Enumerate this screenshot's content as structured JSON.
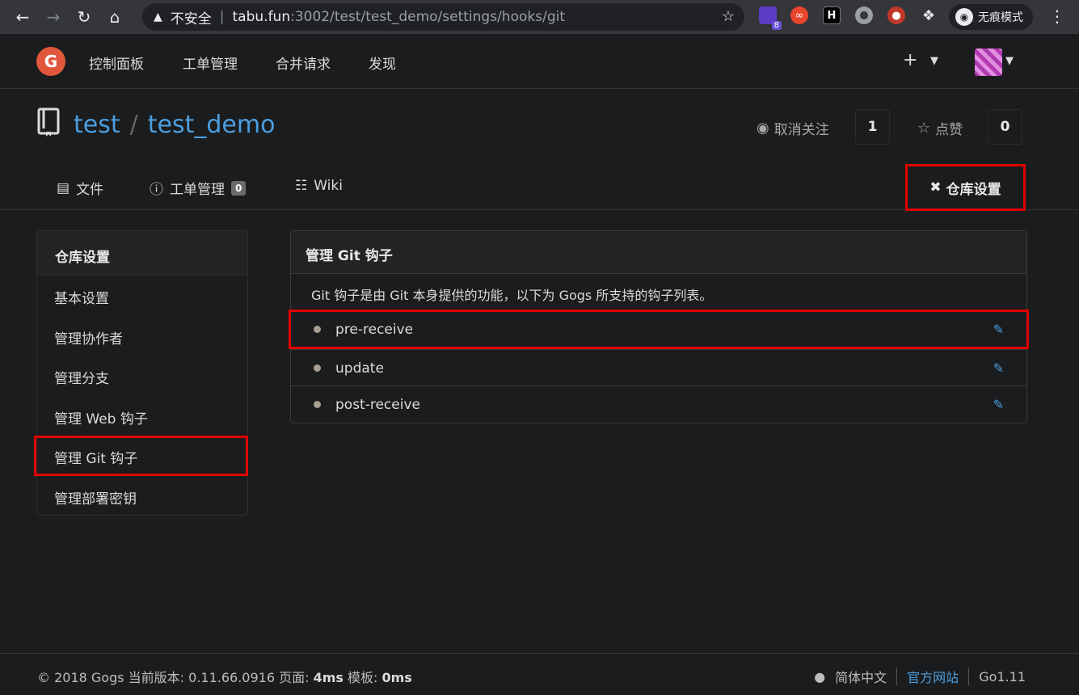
{
  "browser": {
    "insecure_label": "不安全",
    "url_host": "tabu.fun",
    "url_rest": ":3002/test/test_demo/settings/hooks/git",
    "incognito_label": "无痕模式",
    "ext_badge": "8"
  },
  "header": {
    "nav": [
      "控制面板",
      "工单管理",
      "合并请求",
      "发现"
    ]
  },
  "repo": {
    "owner": "test",
    "name": "test_demo",
    "watch_label": "取消关注",
    "watch_count": "1",
    "star_label": "点赞",
    "star_count": "0"
  },
  "tabs": {
    "files": "文件",
    "issues": "工单管理",
    "issues_count": "0",
    "wiki": "Wiki",
    "settings": "仓库设置"
  },
  "sidebar": {
    "title": "仓库设置",
    "items": [
      "基本设置",
      "管理协作者",
      "管理分支",
      "管理 Web 钩子",
      "管理 Git 钩子",
      "管理部署密钥"
    ]
  },
  "panel": {
    "title": "管理 Git 钩子",
    "description": "Git 钩子是由 Git 本身提供的功能，以下为 Gogs 所支持的钩子列表。",
    "hooks": [
      "pre-receive",
      "update",
      "post-receive"
    ]
  },
  "footer": {
    "copyright": "© 2018 Gogs 当前版本: 0.11.66.0916 页面: ",
    "page_time": "4ms",
    "template_label": " 模板: ",
    "template_time": "0ms",
    "language": "简体中文",
    "website": "官方网站",
    "go_version": "Go1.11"
  }
}
